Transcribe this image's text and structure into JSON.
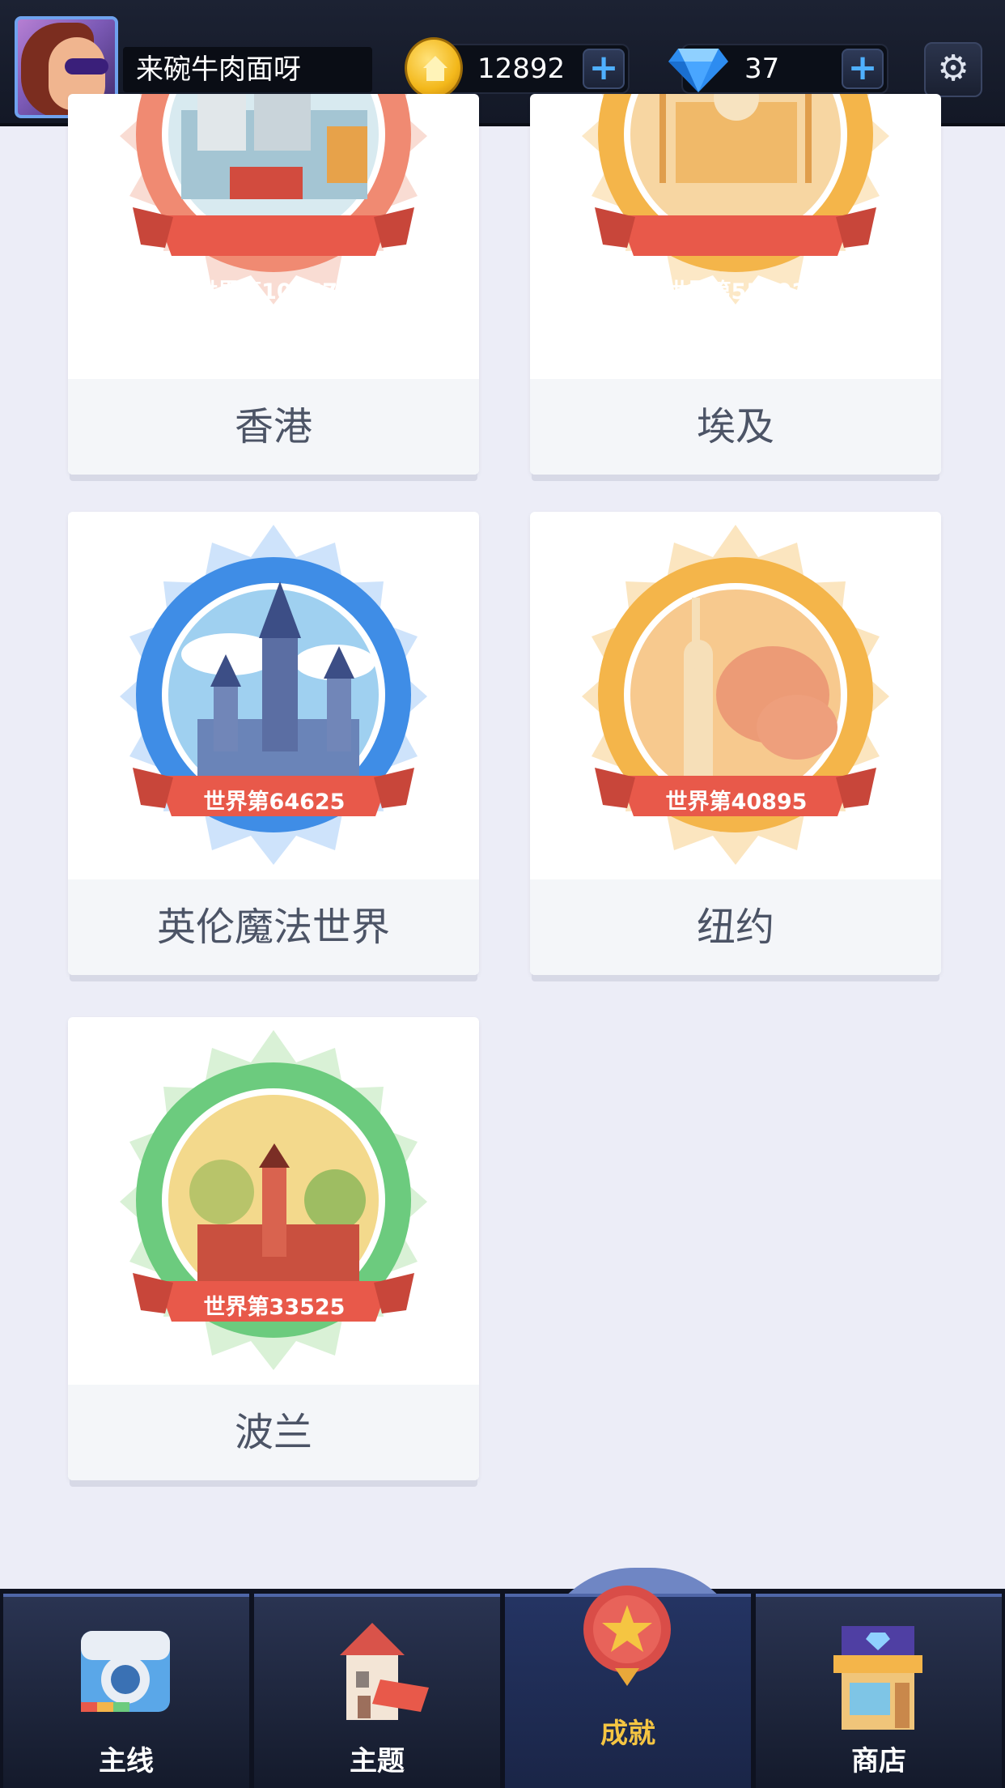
{
  "header": {
    "username": "来碗牛肉面呀",
    "coins": "12892",
    "gems": "37",
    "plus_label": "+",
    "settings_icon": "gear-icon"
  },
  "cards": [
    {
      "name": "香港",
      "rank": "世界第102677",
      "theme": "coral"
    },
    {
      "name": "埃及",
      "rank": "世界第55892",
      "theme": "gold"
    },
    {
      "name": "英伦魔法世界",
      "rank": "世界第64625",
      "theme": "blue"
    },
    {
      "name": "纽约",
      "rank": "世界第40895",
      "theme": "gold"
    },
    {
      "name": "波兰",
      "rank": "世界第33525",
      "theme": "green"
    }
  ],
  "nav": {
    "tabs": [
      {
        "label": "主线",
        "icon": "camera-icon"
      },
      {
        "label": "主题",
        "icon": "house-icon"
      },
      {
        "label": "成就",
        "icon": "medal-icon",
        "active": true
      },
      {
        "label": "商店",
        "icon": "shop-icon"
      }
    ]
  },
  "colors": {
    "accent": "#f5c542",
    "ribbon": "#e8594a",
    "background": "#ecedf7"
  }
}
